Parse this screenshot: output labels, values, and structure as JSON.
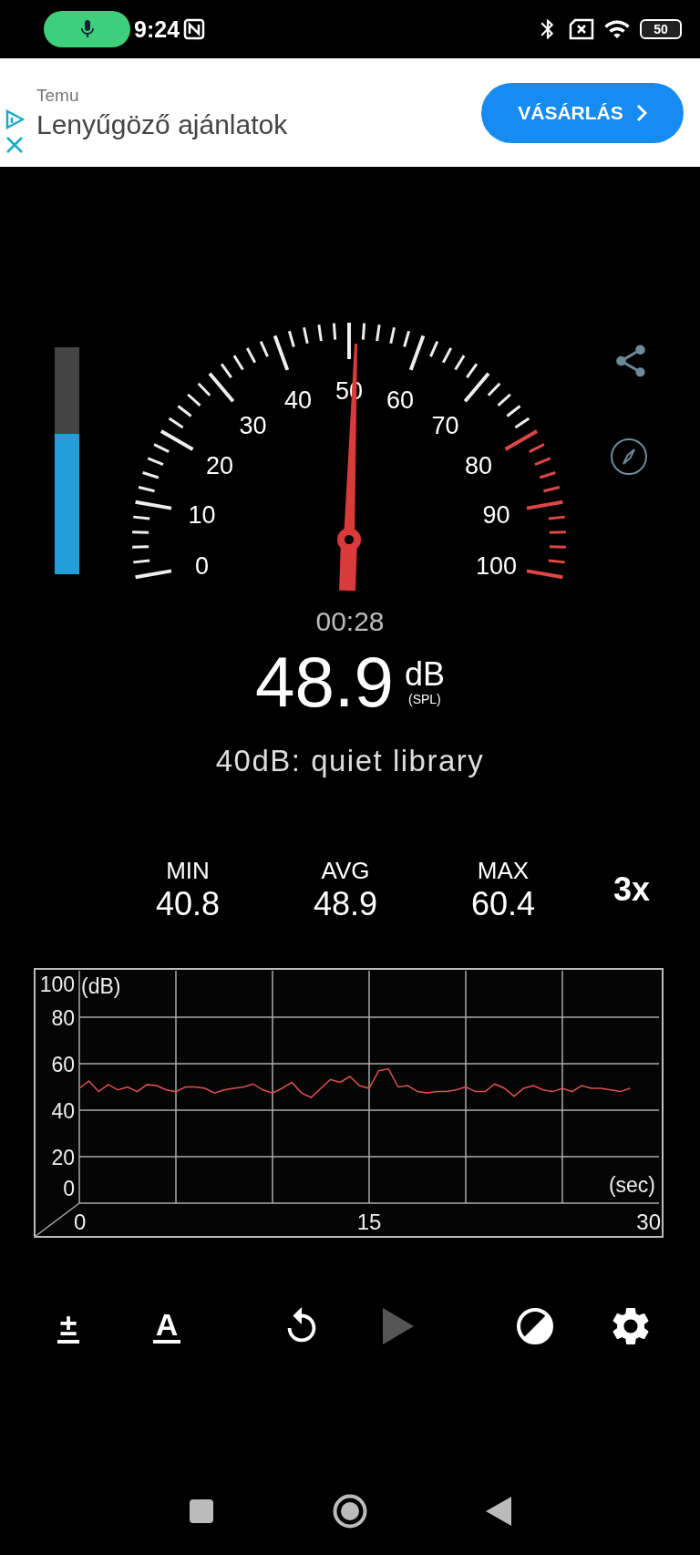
{
  "status_bar": {
    "time": "9:24",
    "battery": "50"
  },
  "ad": {
    "advertiser": "Temu",
    "headline": "Lenyűgöző ajánlatok",
    "button": "VÁSÁRLÁS"
  },
  "meter": {
    "level": 0.62
  },
  "gauge": {
    "scale_labels": [
      "50",
      "40",
      "60",
      "30",
      "70",
      "20",
      "80",
      "10",
      "90",
      "0",
      "100"
    ]
  },
  "elapsed": "00:28",
  "reading": "48.9",
  "unit": "dB",
  "weighting": "(SPL)",
  "description": "40dB: quiet library",
  "stats": [
    {
      "label": "MIN",
      "value": "40.8"
    },
    {
      "label": "AVG",
      "value": "48.9"
    },
    {
      "label": "MAX",
      "value": "60.4"
    }
  ],
  "speed": "3x",
  "chart": {
    "chart_data": {
      "type": "line",
      "xlabel": "(sec)",
      "ylabel": "(dB)",
      "x": [
        0,
        0.5,
        1,
        1.5,
        2,
        2.5,
        3,
        3.5,
        4,
        4.5,
        5,
        5.5,
        6,
        6.5,
        7,
        7.5,
        8,
        8.5,
        9,
        9.5,
        10,
        10.5,
        11,
        11.5,
        12,
        12.5,
        13,
        13.5,
        14,
        14.5,
        15,
        15.5,
        16,
        16.5,
        17,
        17.5,
        18,
        18.5,
        19,
        19.5,
        20,
        20.5,
        21,
        21.5,
        22,
        22.5,
        23,
        23.5,
        24,
        24.5,
        25,
        25.5,
        26,
        26.5,
        27,
        27.5,
        28,
        28.5
      ],
      "series": [
        {
          "color": "#e05050",
          "values": [
            49.4,
            52.6,
            48,
            51,
            48.7,
            50,
            48,
            51,
            50.6,
            48.7,
            48,
            50,
            50,
            49.4,
            47.4,
            48.7,
            49.4,
            50,
            51.3,
            48.7,
            47.4,
            49.4,
            52,
            47.4,
            45.5,
            49.4,
            53.2,
            52,
            54.5,
            50.6,
            49.4,
            57,
            57.8,
            50,
            50.6,
            48,
            47.4,
            48,
            48,
            48.7,
            50,
            48,
            48,
            51.3,
            49.4,
            46,
            49.4,
            50.6,
            48.7,
            48,
            49.4,
            48,
            50.6,
            49.4,
            49.4,
            48.7,
            48,
            49.4
          ]
        }
      ],
      "xlim": [
        0,
        30
      ],
      "ylim": [
        0,
        100
      ],
      "xticks": [
        0,
        15,
        30
      ],
      "yticks": [
        0,
        20,
        40,
        60,
        80,
        100
      ],
      "grid": true
    }
  },
  "toolbar": [
    {
      "kind": "calibrate",
      "glyph": "±",
      "disabled": false
    },
    {
      "kind": "font",
      "glyph": "A",
      "disabled": false
    },
    {
      "kind": "reset",
      "disabled": false
    },
    {
      "kind": "play",
      "disabled": true
    },
    {
      "kind": "theme",
      "disabled": false
    },
    {
      "kind": "settings",
      "disabled": false
    }
  ]
}
